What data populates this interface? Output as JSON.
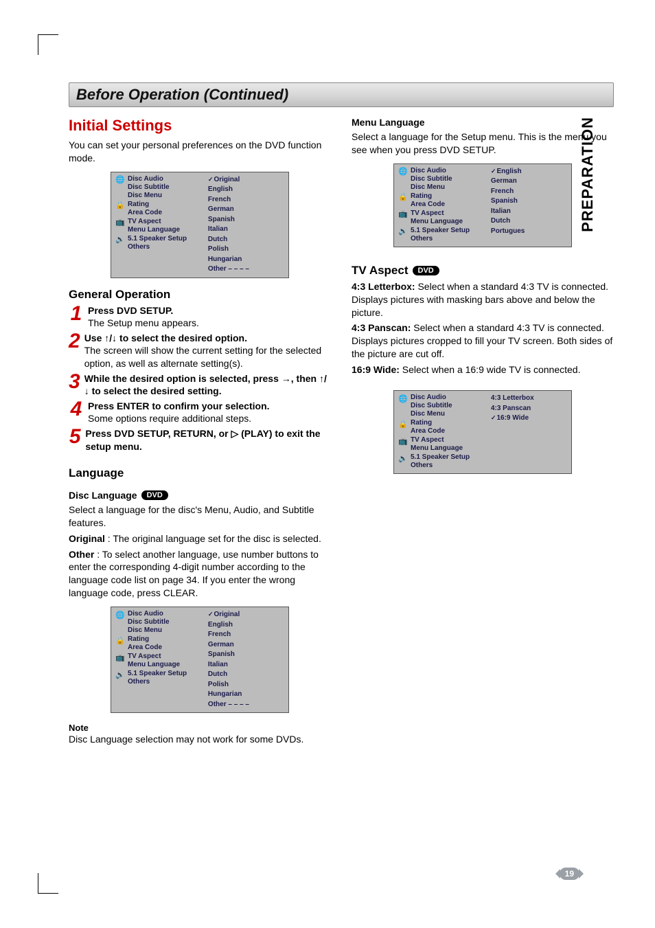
{
  "sidetab": "PREPARATION",
  "page_number": "19",
  "section_title": "Before Operation (Continued)",
  "left": {
    "initial_heading": "Initial Settings",
    "initial_body": "You can set your personal preferences on the DVD function mode.",
    "general_heading": "General Operation",
    "steps": [
      {
        "n": "1",
        "bold": "Press DVD SETUP.",
        "rest": "The Setup menu appears."
      },
      {
        "n": "2",
        "bold": "Use ↑/↓ to select the desired option.",
        "rest": "The screen will show the current setting for the selected option, as well as alternate setting(s)."
      },
      {
        "n": "3",
        "bold": "While the desired option is selected, press →, then ↑/↓ to select the desired setting.",
        "rest": ""
      },
      {
        "n": "4",
        "bold": "Press ENTER to confirm your selection.",
        "rest": "Some options require additional steps."
      },
      {
        "n": "5",
        "bold": "Press DVD SETUP, RETURN, or ▷ (PLAY) to exit the setup menu.",
        "rest": ""
      }
    ],
    "lang_heading": "Language",
    "disc_lang_heading": "Disc Language",
    "dvd_badge": "DVD",
    "disc_lang_body1": "Select a language for the disc's Menu, Audio, and Subtitle features.",
    "disc_lang_original_b": "Original",
    "disc_lang_original_rest": " : The original language set for the disc is selected.",
    "disc_lang_other_b": "Other",
    "disc_lang_other_rest": " : To select another language, use number buttons to enter the corresponding 4-digit number according to the language code list on page 34. If you enter the wrong language code, press CLEAR.",
    "note_label": "Note",
    "note_body": "Disc Language selection may not work for some DVDs."
  },
  "right": {
    "menu_lang_heading": "Menu Language",
    "menu_lang_body": "Select a language for the Setup menu. This is the menu you see when you press DVD SETUP.",
    "tv_aspect_heading": "TV Aspect",
    "dvd_badge": "DVD",
    "tv_aspect_items": [
      {
        "b": "4:3 Letterbox:",
        "rest": " Select when a standard 4:3 TV is connected. Displays pictures with masking bars above and below the picture."
      },
      {
        "b": "4:3 Panscan:",
        "rest": " Select when a standard 4:3 TV is connected. Displays pictures cropped to fill your TV screen. Both sides of the picture are cut off."
      },
      {
        "b": "16:9 Wide:",
        "rest": " Select when a 16:9 wide TV is connected."
      }
    ]
  },
  "osd": {
    "left_groups": [
      {
        "icon": "🌐",
        "items": [
          "Disc Audio",
          "Disc Subtitle",
          "Disc Menu"
        ]
      },
      {
        "icon": "🔒",
        "items": [
          "Rating",
          "Area Code"
        ]
      },
      {
        "icon": "📺",
        "items": [
          "TV Aspect",
          "Menu Language"
        ]
      },
      {
        "icon": "🔊",
        "items": [
          "5.1 Speaker Setup",
          "Others"
        ]
      }
    ],
    "opts_lang_long": [
      "Original",
      "English",
      "French",
      "German",
      "Spanish",
      "Italian",
      "Dutch",
      "Polish",
      "Hungarian",
      "Other  – – – –"
    ],
    "opts_menu_lang": [
      "English",
      "German",
      "French",
      "Spanish",
      "Italian",
      "Dutch",
      "Portugues"
    ],
    "opts_aspect": [
      "4:3  Letterbox",
      "4:3  Panscan",
      "16:9 Wide"
    ]
  }
}
